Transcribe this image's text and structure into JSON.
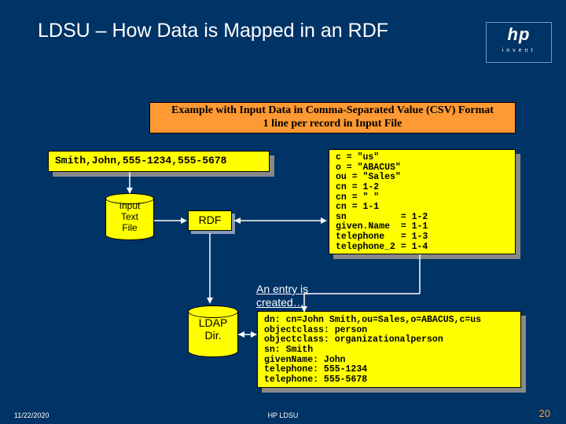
{
  "header": {
    "title": "LDSU – How Data is Mapped in an RDF",
    "logo_main": "hp",
    "logo_sub": "invent"
  },
  "banner": {
    "line1": "Example with Input Data in Comma-Separated Value (CSV) Format",
    "line2": "1 line per record in Input File"
  },
  "csv_record": "Smith,John,555-1234,555-5678",
  "input_cylinder": "Input\nText\nFile",
  "rdf_label": "RDF",
  "mapping": "c = \"us\"\no = \"ABACUS\"\nou = \"Sales\"\ncn = 1-2\ncn = \" \"\ncn = 1-1\nsn          = 1-2\ngiven.Name  = 1-1\ntelephone   = 1-3\ntelephone_2 = 1-4",
  "entry_label": "An entry is\ncreated…",
  "ldap_label": "LDAP\nDir.",
  "ldap_entry": "dn: cn=John Smith,ou=Sales,o=ABACUS,c=us\nobjectclass: person\nobjectclass: organizationalperson\nsn: Smith\ngivenName: John\ntelephone: 555-1234\ntelephone: 555-5678",
  "footer": {
    "date": "11/22/2020",
    "center": "HP LDSU",
    "page": "20"
  }
}
